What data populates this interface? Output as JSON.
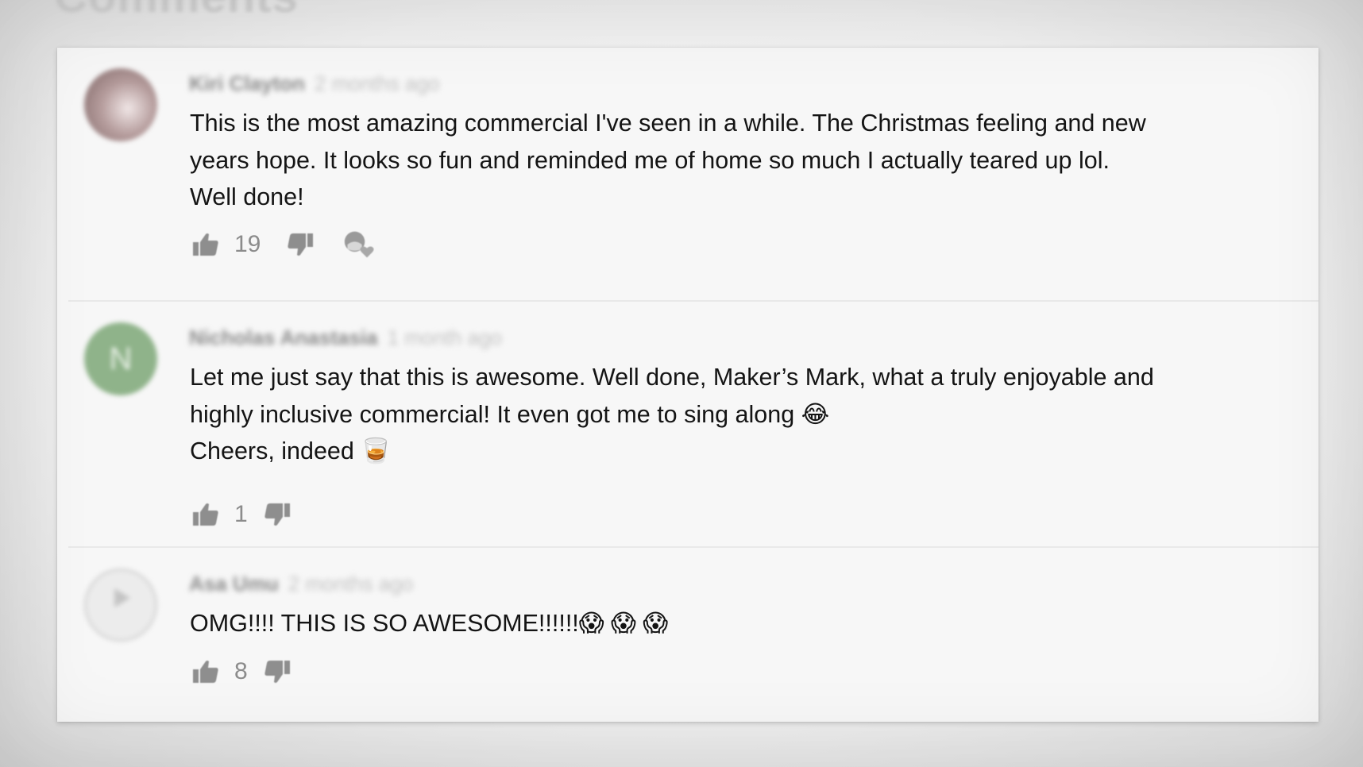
{
  "section": {
    "title": "Comments"
  },
  "comments": [
    {
      "author": "Kiri Clayton",
      "time": "2 months ago",
      "text": "This is the most amazing commercial I've seen in a while. The Christmas feeling and new\nyears hope. It looks so fun and reminded me of home so much I actually teared up lol.\nWell done!",
      "likes": "19",
      "avatar_initial": "",
      "has_heart": true
    },
    {
      "author": "Nicholas Anastasia",
      "time": "1 month ago",
      "text": "Let me just say that this is awesome. Well done, Maker’s Mark, what a truly enjoyable and\nhighly inclusive commercial! It even got me to sing along 😂\nCheers, indeed 🥃",
      "likes": "1",
      "avatar_initial": "N",
      "has_heart": false
    },
    {
      "author": "Asa Umu",
      "time": "2 months ago",
      "text": "OMG!!!! THIS IS SO AWESOME!!!!!!😱 😱 😱",
      "likes": "8",
      "avatar_initial": "",
      "has_heart": false
    }
  ],
  "icons": {
    "like": "thumbs-up-icon",
    "dislike": "thumbs-down-icon",
    "creator_heart": "creator-heart-icon"
  },
  "colors": {
    "icon_gray": "#8e8e8e",
    "text": "#141414",
    "count": "#8c8c8c"
  }
}
